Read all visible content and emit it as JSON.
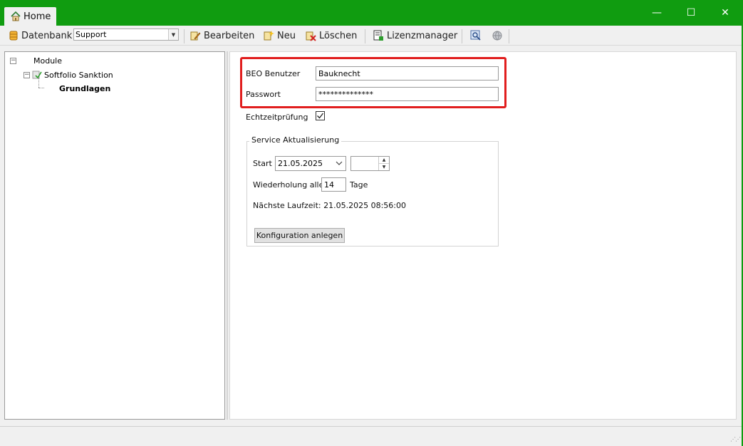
{
  "window": {
    "tab_label": "Home",
    "controls": {
      "minimize": "—",
      "maximize": "☐",
      "close": "✕"
    },
    "accent_color": "#109c10"
  },
  "toolbar": {
    "database_label": "Datenbank",
    "database_value": "Support",
    "edit_label": "Bearbeiten",
    "new_label": "Neu",
    "delete_label": "Löschen",
    "license_label": "Lizenzmanager"
  },
  "tree": {
    "root": "Module",
    "child": "Softfolio Sanktion",
    "leaf": "Grundlagen"
  },
  "form": {
    "user_label": "BEO Benutzer",
    "user_value": "Bauknecht",
    "password_label": "Passwort",
    "password_value": "**************",
    "realtime_label": "Echtzeitprüfung",
    "realtime_checked": true,
    "highlight_color": "#e11e1e"
  },
  "service": {
    "group_title": "Service Aktualisierung",
    "start_label": "Start",
    "start_date": "21.05.2025",
    "start_time": "",
    "repeat_label": "Wiederholung alle:",
    "repeat_value": "14",
    "repeat_unit": "Tage",
    "next_run": "Nächste Laufzeit: 21.05.2025 08:56:00",
    "create_button": "Konfiguration anlegen"
  }
}
